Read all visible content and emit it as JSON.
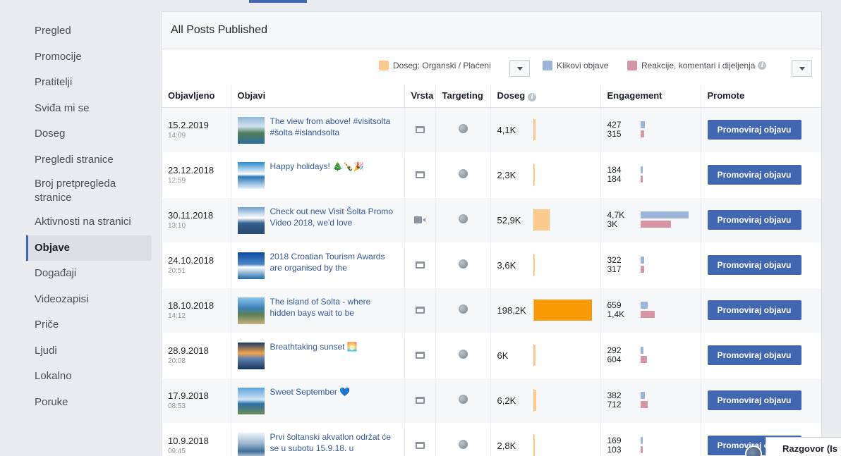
{
  "sidebar": {
    "items": [
      {
        "label": "Pregled"
      },
      {
        "label": "Promocije"
      },
      {
        "label": "Pratitelji"
      },
      {
        "label": "Sviđa mi se"
      },
      {
        "label": "Doseg"
      },
      {
        "label": "Pregledi stranice"
      },
      {
        "label": "Broj pretpregleda stranice"
      },
      {
        "label": "Aktivnosti na stranici"
      },
      {
        "label": "Objave"
      },
      {
        "label": "Događaji"
      },
      {
        "label": "Videozapisi"
      },
      {
        "label": "Priče"
      },
      {
        "label": "Ljudi"
      },
      {
        "label": "Lokalno"
      },
      {
        "label": "Poruke"
      }
    ],
    "active": "Objave"
  },
  "panel": {
    "title": "All Posts Published"
  },
  "legend": {
    "reach_label": "Doseg: Organski / Plaćeni",
    "clicks_label": "Klikovi objave",
    "reactions_label": "Reakcije, komentari i dijeljenja",
    "colors": {
      "reach": "#fcc98d",
      "clicks": "#9cb4d8",
      "reactions": "#d694a4"
    }
  },
  "columns": {
    "published": "Objavljeno",
    "post": "Objavi",
    "type": "Vrsta",
    "targeting": "Targeting",
    "reach": "Doseg",
    "engagement": "Engagement",
    "promote": "Promote"
  },
  "rows": [
    {
      "date": "15.2.2019",
      "time": "14:09",
      "text": "The view from above! #visitsolta #šolta #islandsolta",
      "type": "status-icon",
      "reach": "4,1K",
      "reach_value": 4.1,
      "clicks": "427",
      "clicks_value": 427,
      "reactions": "315",
      "reactions_value": 315,
      "button": "Promoviraj objavu"
    },
    {
      "date": "23.12.2018",
      "time": "12:59",
      "text": "Happy holidays! 🎄🍾🎉",
      "type": "status-icon",
      "reach": "2,3K",
      "reach_value": 2.3,
      "clicks": "184",
      "clicks_value": 184,
      "reactions": "184",
      "reactions_value": 184,
      "button": "Promoviraj objavu"
    },
    {
      "date": "30.11.2018",
      "time": "13:10",
      "text": "Check out new Visit Šolta Promo Video 2018, we'd love",
      "type": "video-icon",
      "reach": "52,9K",
      "reach_value": 52.9,
      "clicks": "4,7K",
      "clicks_value": 4700,
      "reactions": "3K",
      "reactions_value": 3000,
      "button": "Promoviraj objavu"
    },
    {
      "date": "24.10.2018",
      "time": "20:51",
      "text": "2018 Croatian Tourism Awards are organised by the",
      "type": "status-icon",
      "reach": "3,6K",
      "reach_value": 3.6,
      "clicks": "322",
      "clicks_value": 322,
      "reactions": "317",
      "reactions_value": 317,
      "button": "Promoviraj objavu"
    },
    {
      "date": "18.10.2018",
      "time": "14:12",
      "text": "The island of Solta - where hidden bays wait to be",
      "type": "status-icon",
      "reach": "198,2K",
      "reach_value": 198.2,
      "clicks": "659",
      "clicks_value": 659,
      "reactions": "1,4K",
      "reactions_value": 1400,
      "button": "Promoviraj objavu"
    },
    {
      "date": "28.9.2018",
      "time": "20:08",
      "text": "Breathtaking sunset 🌅",
      "type": "status-icon",
      "reach": "6K",
      "reach_value": 6,
      "clicks": "292",
      "clicks_value": 292,
      "reactions": "604",
      "reactions_value": 604,
      "button": "Promoviraj objavu"
    },
    {
      "date": "17.9.2018",
      "time": "08:53",
      "text": "Sweet September 💙",
      "type": "status-icon",
      "reach": "6,2K",
      "reach_value": 6.2,
      "clicks": "382",
      "clicks_value": 382,
      "reactions": "712",
      "reactions_value": 712,
      "button": "Promoviraj objavu"
    },
    {
      "date": "10.9.2018",
      "time": "09:45",
      "text": "Prvi šoltanski akvatlon održat će se u subotu 15.9.18. u",
      "type": "status-icon",
      "reach": "2,8K",
      "reach_value": 2.8,
      "clicks": "169",
      "clicks_value": 169,
      "reactions": "103",
      "reactions_value": 103,
      "button": "Promoviraj objavu"
    }
  ],
  "chat": {
    "label": "Razgovor (Is"
  }
}
